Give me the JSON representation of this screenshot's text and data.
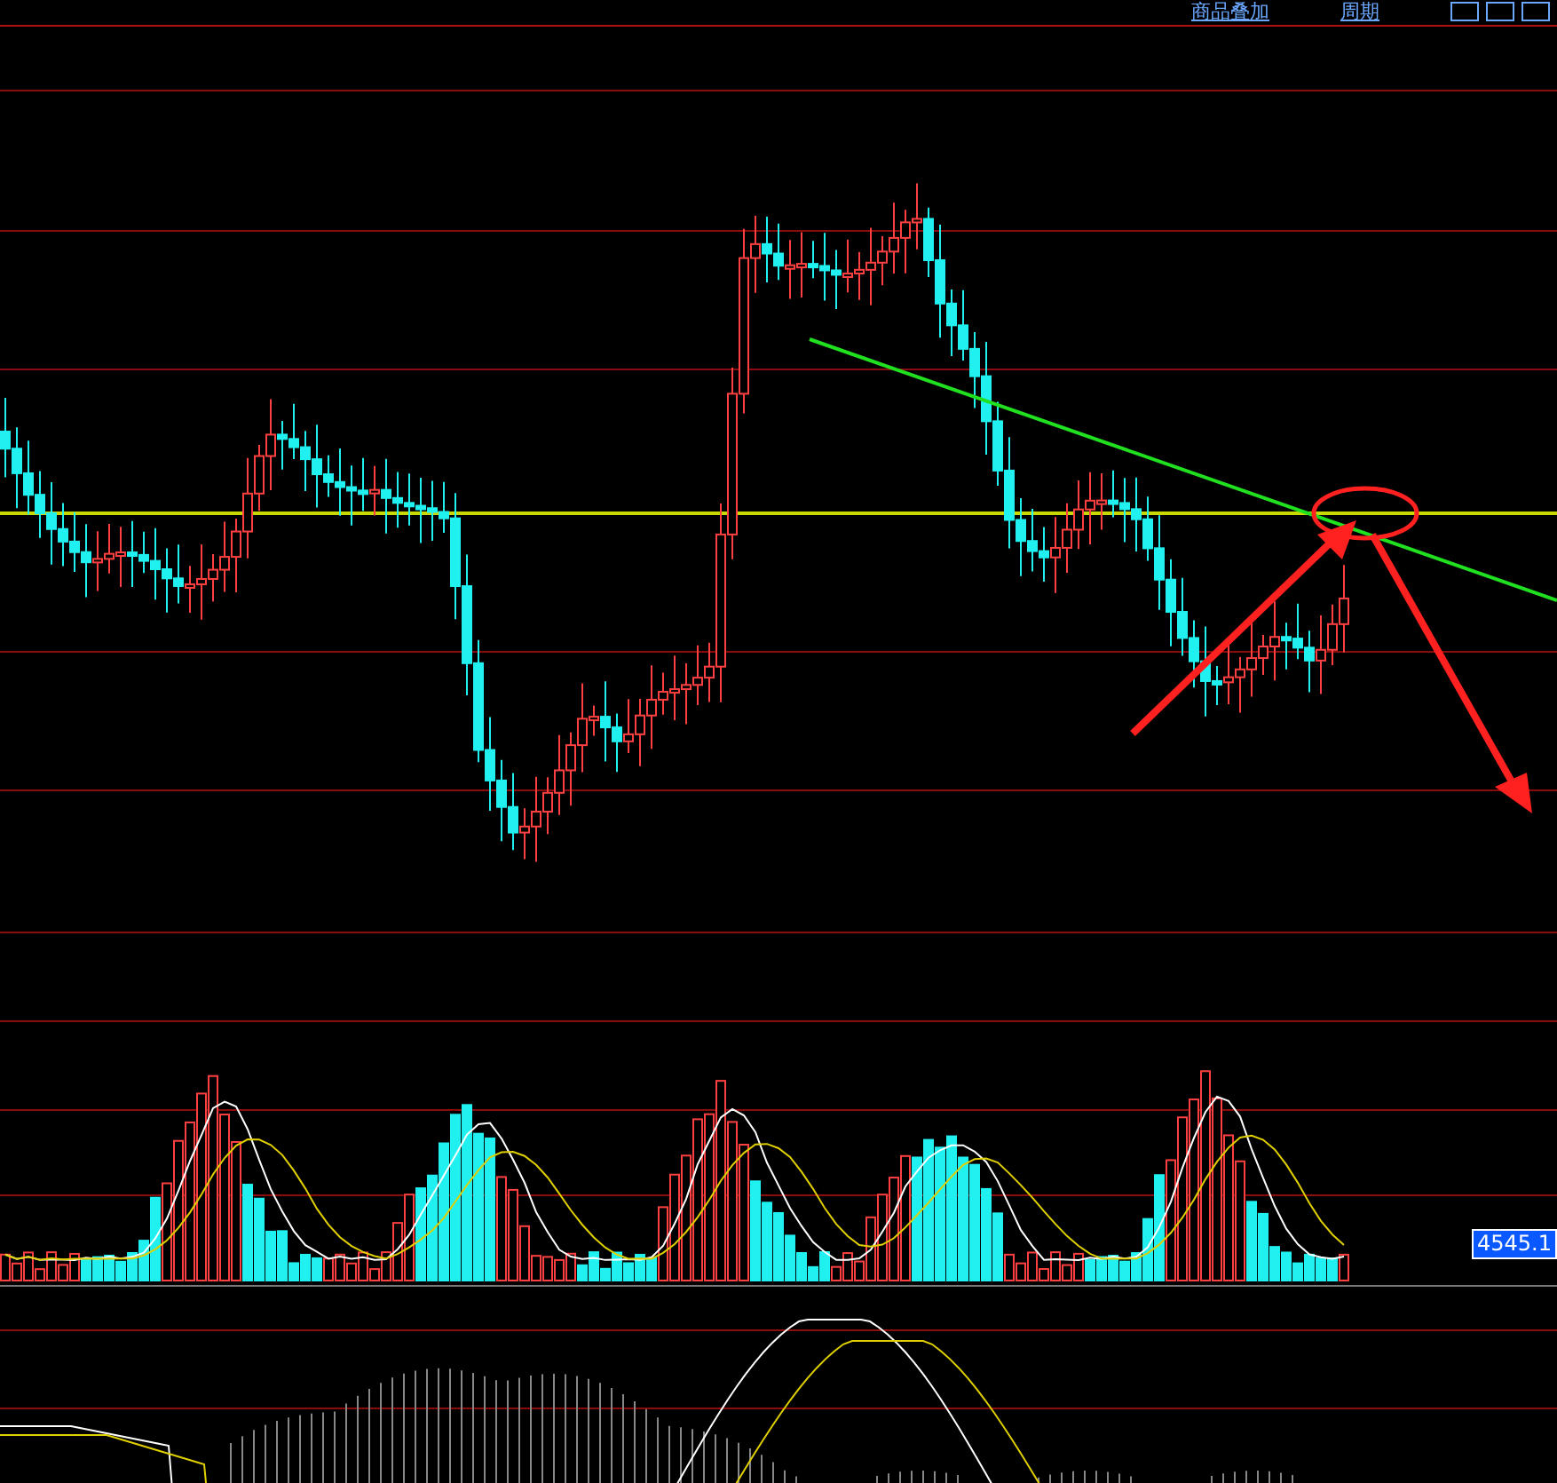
{
  "toolbar": {
    "links": [
      "商品叠加",
      "周期"
    ]
  },
  "price_label": "4545.1"
}
